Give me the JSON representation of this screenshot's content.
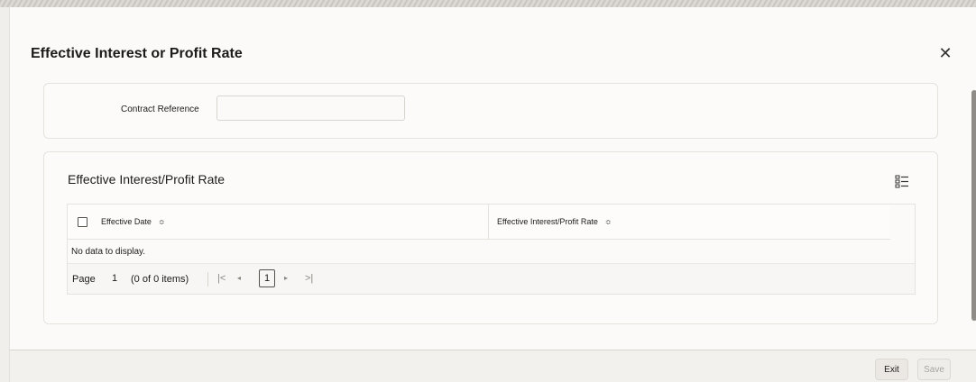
{
  "dialog": {
    "title": "Effective Interest or Profit Rate",
    "close_icon": "close-icon"
  },
  "form": {
    "contract_reference_label": "Contract Reference",
    "contract_reference_value": ""
  },
  "grid": {
    "title": "Effective Interest/Profit Rate",
    "columns_icon": "column-list-icon",
    "columns": [
      {
        "label": "Effective Date",
        "sort_icon": "sort-icon"
      },
      {
        "label": "Effective Interest/Profit Rate",
        "sort_icon": "sort-icon"
      }
    ],
    "empty_text": "No data to display.",
    "pager": {
      "page_label": "Page",
      "page_value": "1",
      "count_text": "(0 of 0 items)",
      "current_page": "1",
      "first_icon": "|<",
      "prev_icon": "◂",
      "next_icon": "▸",
      "last_icon": ">|"
    }
  },
  "footer": {
    "exit_label": "Exit",
    "save_label": "Save"
  }
}
